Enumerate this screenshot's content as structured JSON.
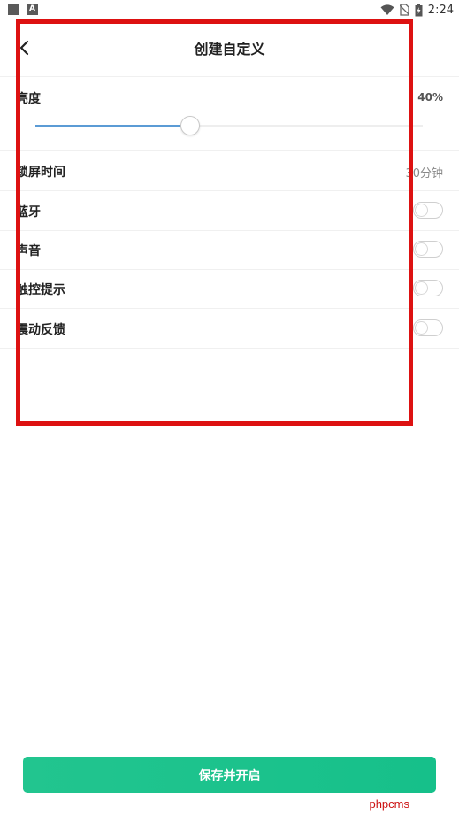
{
  "status_bar": {
    "time": "2:24",
    "left_icons": [
      "square-icon",
      "a-icon"
    ],
    "right_icons": [
      "wifi-icon",
      "sim-off-icon",
      "battery-icon"
    ]
  },
  "header": {
    "title": "创建自定义",
    "back_icon": "chevron-left-icon"
  },
  "brightness": {
    "label": "亮度",
    "value_text": "40%",
    "level": 0.4
  },
  "settings": [
    {
      "label": "锁屏时间",
      "value": "30分钟",
      "type": "value"
    },
    {
      "label": "蓝牙",
      "type": "toggle",
      "on": false
    },
    {
      "label": "声音",
      "type": "toggle",
      "on": false
    },
    {
      "label": "触控提示",
      "type": "toggle",
      "on": false
    },
    {
      "label": "震动反馈",
      "type": "toggle",
      "on": false
    }
  ],
  "save_button": {
    "label": "保存并开启"
  },
  "watermark": "phpcms",
  "colors": {
    "accent": "#1cc38c",
    "slider_fill": "#5b9bd5",
    "highlight": "#dd1111"
  }
}
